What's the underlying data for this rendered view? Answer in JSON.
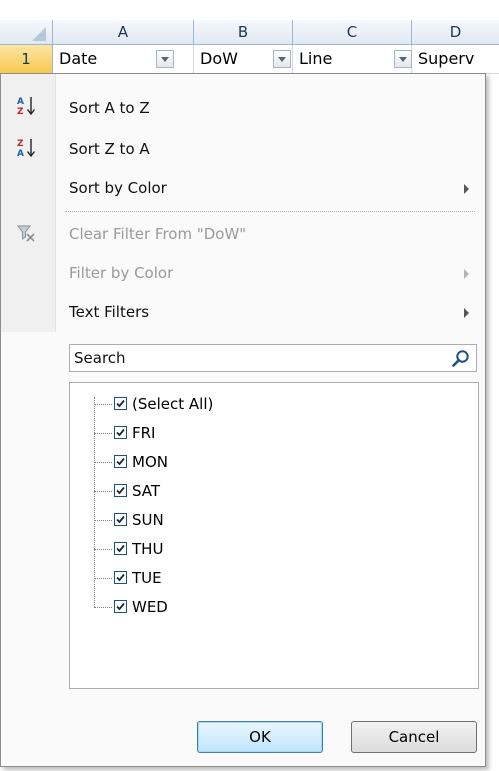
{
  "sheet": {
    "columns": [
      "A",
      "B",
      "C",
      "D"
    ],
    "row_number": "1",
    "header_cells": [
      "Date",
      "DoW",
      "Line",
      "Superv"
    ]
  },
  "filter_menu": {
    "sort_a_z": "Sort A to Z",
    "sort_z_a": "Sort Z to A",
    "sort_by_color": "Sort by Color",
    "clear_filter": "Clear Filter From \"DoW\"",
    "filter_by_color": "Filter by Color",
    "text_filters": "Text Filters",
    "search_placeholder": "Search",
    "items": [
      {
        "label": "(Select All)",
        "checked": true
      },
      {
        "label": "FRI",
        "checked": true
      },
      {
        "label": "MON",
        "checked": true
      },
      {
        "label": "SAT",
        "checked": true
      },
      {
        "label": "SUN",
        "checked": true
      },
      {
        "label": "THU",
        "checked": true
      },
      {
        "label": "TUE",
        "checked": true
      },
      {
        "label": "WED",
        "checked": true
      }
    ],
    "ok_label": "OK",
    "cancel_label": "Cancel"
  },
  "colors": {
    "row_header_selected": "#f7c94d",
    "ok_border": "#3c7fb1"
  },
  "icons": {
    "sort_asc": "sort-ascending-icon",
    "sort_desc": "sort-descending-icon",
    "clear_filter": "clear-filter-icon",
    "search": "magnifier-icon"
  }
}
